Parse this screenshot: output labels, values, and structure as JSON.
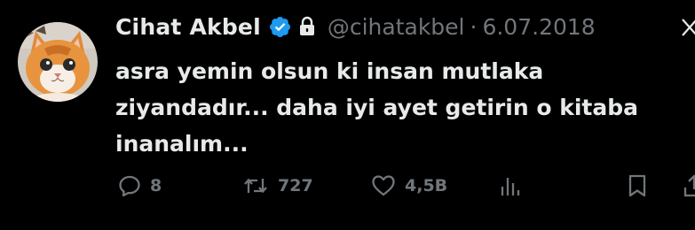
{
  "tweet": {
    "author_name": "Cihat Akbel",
    "handle": "@cihatakbel",
    "separator": "·",
    "date": "6.07.2018",
    "text": "asra yemin olsun ki insan mutlaka ziyandadır... daha iyi ayet getirin o kitaba inanalım...",
    "verified": true,
    "protected": true
  },
  "actions": {
    "replies": "8",
    "reposts": "727",
    "likes": "4,5B"
  },
  "icons": {
    "avatar": "orange-cat-avatar",
    "verified": "verified-badge-icon",
    "lock": "lock-icon",
    "more": "more-icon",
    "reply": "reply-icon",
    "repost": "repost-icon",
    "like": "heart-icon",
    "views": "views-icon",
    "bookmark": "bookmark-icon",
    "share": "share-icon"
  },
  "colors": {
    "background": "#000000",
    "primary_text": "#e7e9ea",
    "secondary_text": "#71767b",
    "verified_blue": "#1d9bf0"
  }
}
